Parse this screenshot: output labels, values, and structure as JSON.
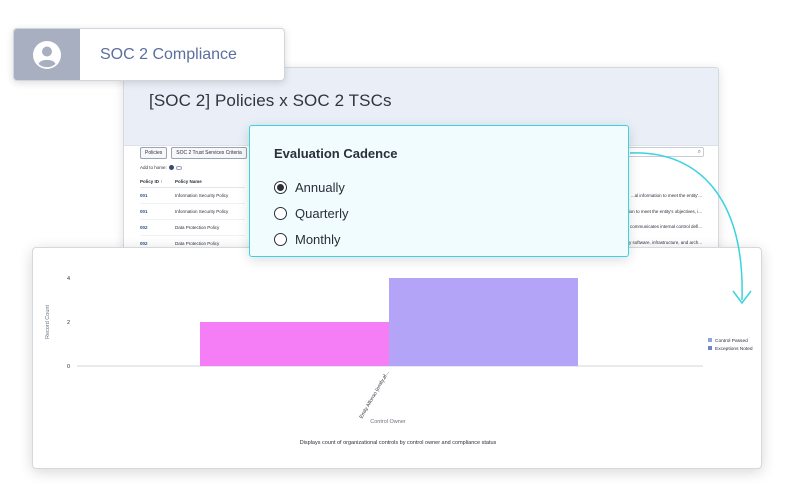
{
  "badge": {
    "icon": "user-icon",
    "label": "SOC 2 Compliance"
  },
  "back_panel": {
    "title": "[SOC 2] Policies x SOC 2 TSCs",
    "chips": [
      "Policies",
      "SOC 2 Trust Services Criteria"
    ],
    "add_home": "Add to home:",
    "columns": [
      "Policy ID",
      "Policy Name"
    ],
    "rows": [
      {
        "id": "001",
        "name": "Information Security Policy",
        "desc": "...al information to meet the entity'..."
      },
      {
        "id": "001",
        "name": "Information Security Policy",
        "desc": "...ion to meet the entity's objectives, i..."
      },
      {
        "id": "002",
        "name": "Data Protection Policy",
        "desc": "... communicates internal control defi..."
      },
      {
        "id": "002",
        "name": "Data Protection Policy",
        "desc": "...y software, infrastructure, and arch..."
      }
    ]
  },
  "cadence": {
    "title": "Evaluation Cadence",
    "options": [
      "Annually",
      "Quarterly",
      "Monthly"
    ],
    "selected": "Annually"
  },
  "chart_data": {
    "type": "bar",
    "categories": [
      "Emily Alfonso (emily.af..."
    ],
    "series": [
      {
        "name": "Control Passed",
        "values": [
          2
        ],
        "color": "#f57ef7"
      },
      {
        "name": "Exceptions Noted",
        "values": [
          4
        ],
        "color": "#b4a4f8"
      }
    ],
    "xlabel": "Control Owner",
    "ylabel": "Record Count",
    "yticks": [
      0,
      2,
      4
    ],
    "ylim": [
      0,
      4
    ],
    "legend": "right",
    "caption": "Displays count of organizational controls by control owner and compliance status"
  },
  "colors": {
    "accent": "#3ad3e0",
    "badge_text": "#5b6f9f",
    "link": "#2d4d8f"
  }
}
